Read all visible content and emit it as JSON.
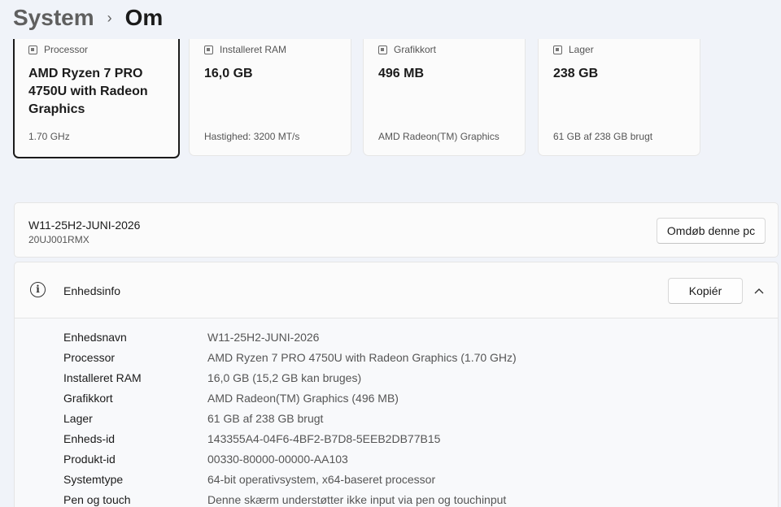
{
  "breadcrumb": {
    "parent": "System",
    "separator": "›",
    "current": "Om"
  },
  "cards": [
    {
      "label": "Processor",
      "value": "AMD Ryzen 7 PRO 4750U with Radeon Graphics",
      "sub": "1.70 GHz",
      "icon": "processor-icon",
      "selected": true
    },
    {
      "label": "Installeret RAM",
      "value": "16,0 GB",
      "sub": "Hastighed: 3200 MT/s",
      "icon": "ram-icon",
      "selected": false
    },
    {
      "label": "Grafikkort",
      "value": "496 MB",
      "sub": "AMD Radeon(TM) Graphics",
      "icon": "graphics-card-icon",
      "selected": false
    },
    {
      "label": "Lager",
      "value": "238 GB",
      "sub": "61 GB af 238 GB brugt",
      "icon": "storage-icon",
      "selected": false
    }
  ],
  "device": {
    "name": "W11-25H2-JUNI-2026",
    "model": "20UJ001RMX",
    "rename_label": "Omdøb denne pc"
  },
  "info": {
    "title": "Enhedsinfo",
    "copy_label": "Kopiér",
    "rows": [
      {
        "key": "Enhedsnavn",
        "value": "W11-25H2-JUNI-2026"
      },
      {
        "key": "Processor",
        "value": "AMD Ryzen 7 PRO 4750U with Radeon Graphics (1.70 GHz)"
      },
      {
        "key": "Installeret RAM",
        "value": "16,0 GB (15,2 GB kan bruges)"
      },
      {
        "key": "Grafikkort",
        "value": "AMD Radeon(TM) Graphics (496 MB)"
      },
      {
        "key": "Lager",
        "value": "61 GB af 238 GB brugt"
      },
      {
        "key": "Enheds-id",
        "value": "143355A4-04F6-4BF2-B7D8-5EEB2DB77B15"
      },
      {
        "key": "Produkt-id",
        "value": "00330-80000-00000-AA103"
      },
      {
        "key": "Systemtype",
        "value": "64-bit operativsystem, x64-baseret processor"
      },
      {
        "key": "Pen og touch",
        "value": "Denne skærm understøtter ikke input via pen og touchinput"
      }
    ]
  }
}
